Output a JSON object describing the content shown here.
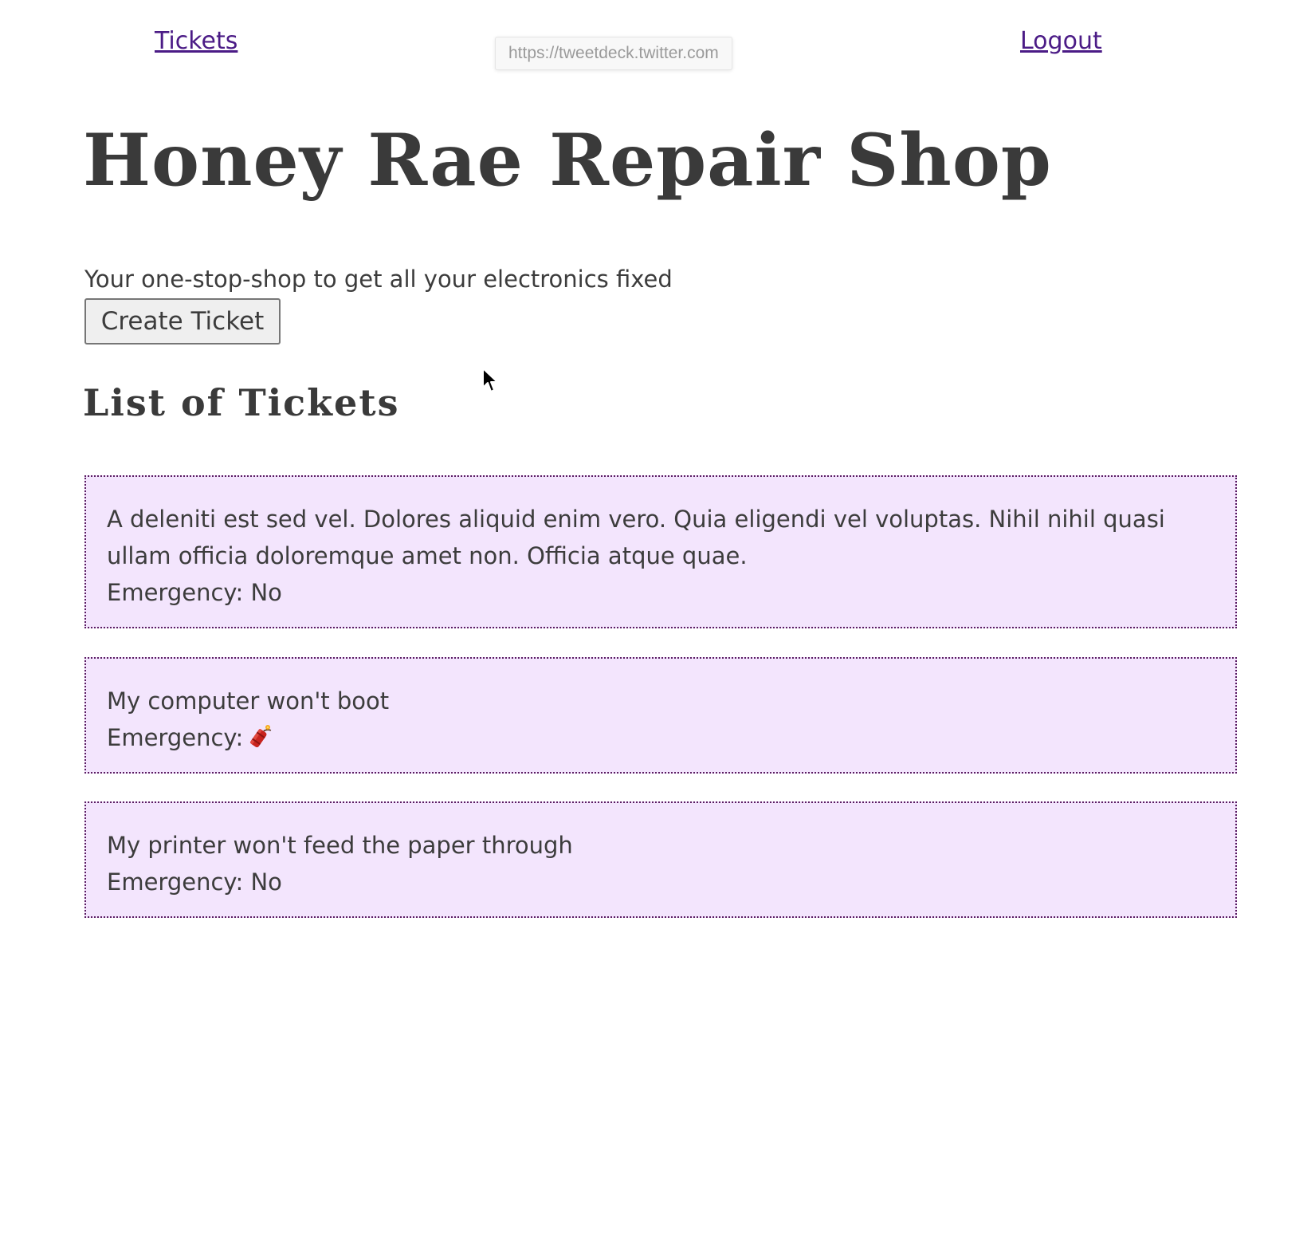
{
  "nav": {
    "tickets_label": "Tickets",
    "logout_label": "Logout"
  },
  "url_tooltip": "https://tweetdeck.twitter.com",
  "header": {
    "title": "Honey Rae Repair Shop",
    "tagline": "Your one-stop-shop to get all your electronics fixed"
  },
  "actions": {
    "create_ticket_label": "Create Ticket"
  },
  "tickets_section": {
    "title": "List of Tickets",
    "tickets": [
      {
        "description": "A deleniti est sed vel. Dolores aliquid enim vero. Quia eligendi vel voluptas. Nihil nihil quasi ullam officia doloremque amet non. Officia atque quae.",
        "emergency_label": "Emergency: No"
      },
      {
        "description": "My computer won't boot",
        "emergency_label": "Emergency:",
        "emergency_icon": "dynamite-icon"
      },
      {
        "description": "My printer won't feed the paper through",
        "emergency_label": "Emergency: No"
      }
    ]
  },
  "colors": {
    "link": "#4b1b86",
    "ticket_background": "#f3e5fd",
    "ticket_border": "#5b1d63",
    "text": "#3c3c3c"
  }
}
